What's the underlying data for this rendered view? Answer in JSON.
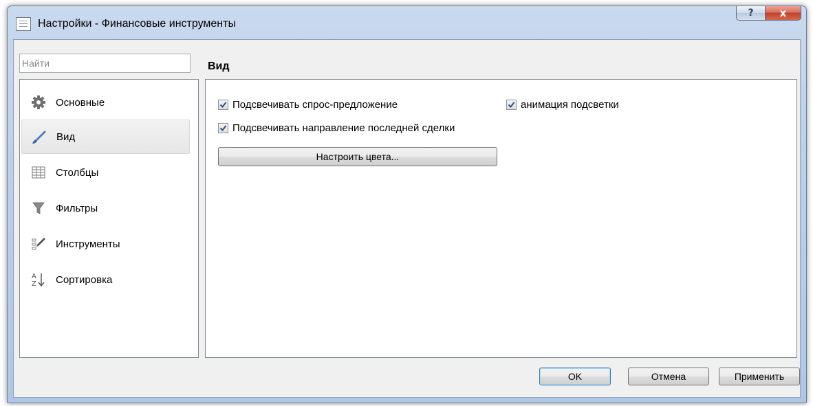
{
  "window": {
    "title": "Настройки - Финансовые инструменты",
    "help_glyph": "?",
    "close_glyph": "x"
  },
  "search": {
    "placeholder": "Найти",
    "value": ""
  },
  "section": {
    "title": "Вид"
  },
  "sidebar": {
    "items": [
      {
        "label": "Основные",
        "icon": "gear-icon",
        "selected": false
      },
      {
        "label": "Вид",
        "icon": "brush-icon",
        "selected": true
      },
      {
        "label": "Столбцы",
        "icon": "columns-icon",
        "selected": false
      },
      {
        "label": "Фильтры",
        "icon": "filter-icon",
        "selected": false
      },
      {
        "label": "Инструменты",
        "icon": "tools-icon",
        "selected": false
      },
      {
        "label": "Сортировка",
        "icon": "sort-az-icon",
        "selected": false
      }
    ]
  },
  "view_settings": {
    "highlight_bid_ask": {
      "label": "Подсвечивать спрос-предложение",
      "checked": true
    },
    "highlight_animation": {
      "label": "анимация подсветки",
      "checked": true
    },
    "highlight_last_trade": {
      "label": "Подсвечивать направление последней сделки",
      "checked": true
    },
    "configure_colors_label": "Настроить цвета..."
  },
  "footer": {
    "ok_label": "OK",
    "cancel_label": "Отмена",
    "apply_label": "Применить"
  }
}
